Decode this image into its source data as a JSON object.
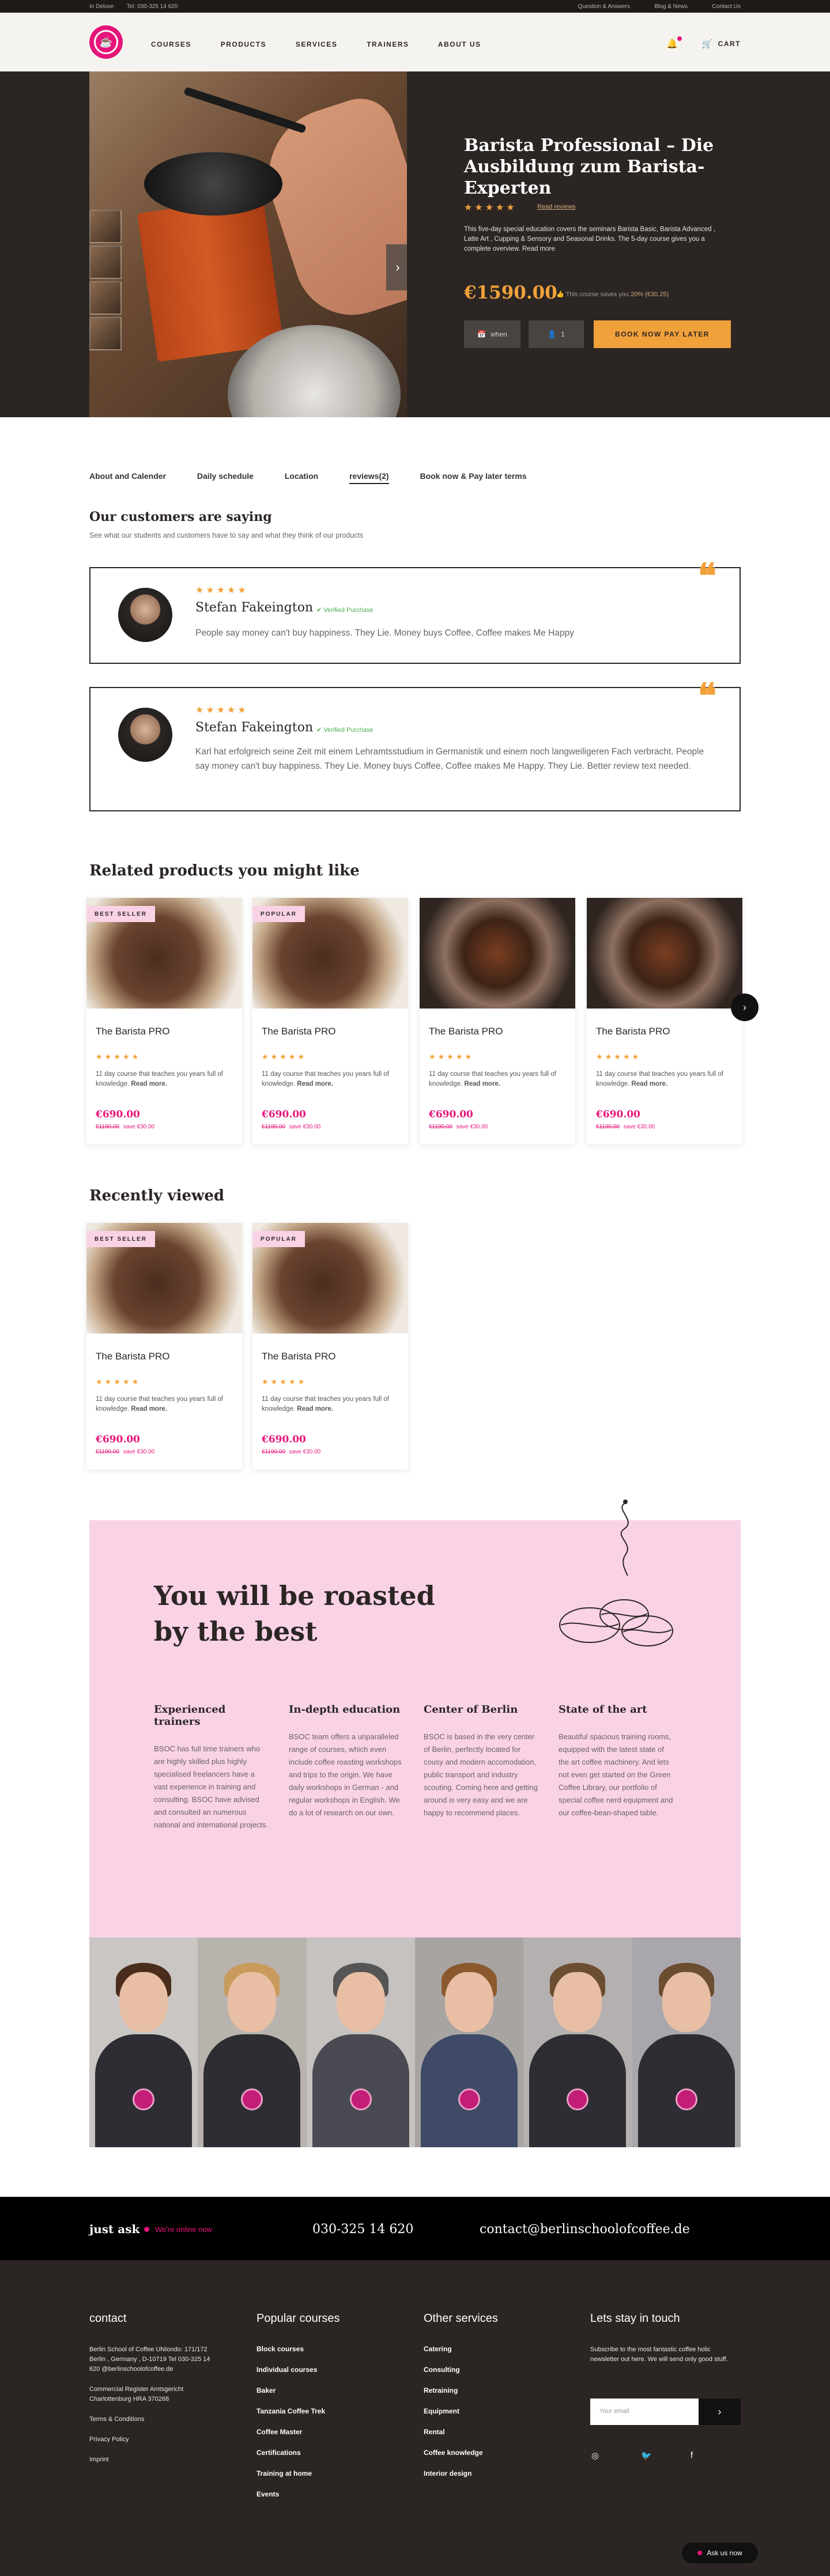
{
  "topbar": {
    "location": "In Deluxe",
    "phone": "Tel: 030-325 14 620",
    "links": [
      "Question & Answers",
      "Blog & News",
      "Contact Us"
    ]
  },
  "header": {
    "nav": [
      "COURSES",
      "PRODUCTS",
      "SERVICES",
      "TRAINERS",
      "ABOUT US"
    ],
    "cart": "CART"
  },
  "hero": {
    "title": "Barista Professional – Die Ausbildung zum Barista-Experten",
    "rating": "★★★★★",
    "read_reviews": "Read reviews",
    "description": "This five-day special education covers the seminars Barista Basic, Barista Advanced , Latte Art , Cupping & Sensory and Seasonal Drinks. The 5-day course gives you a complete overview. Read more",
    "price": "€1590.00",
    "save_prefix": "This course saves you",
    "save_value": "20% (€30.25)",
    "when_label": "when",
    "qty_label": "1",
    "book_button": "BOOK NOW PAY LATER"
  },
  "tabs": [
    "About and Calender",
    "Daily schedule",
    "Location",
    "reviews(2)",
    "Book now & Pay later terms"
  ],
  "reviews_section": {
    "title": "Our customers are saying",
    "subtitle": "See what our students and customers have to say and what they think of our products",
    "items": [
      {
        "stars": "★★★★★",
        "name": "Stefan Fakeington",
        "verified": "Verified Purchase",
        "text": "People say money can't buy happiness. They Lie. Money buys Coffee, Coffee makes Me Happy"
      },
      {
        "stars": "★★★★★",
        "name": "Stefan Fakeington",
        "verified": "Verified Purchase",
        "text": "Karl hat erfolgreich seine Zeit mit einem Lehramtsstudium in Germanistik und einem noch langweiligeren Fach verbracht. People say money can't buy happiness. They Lie. Money buys Coffee, Coffee makes Me Happy. They Lie. Better review text needed."
      }
    ]
  },
  "related": {
    "title": "Related products you might like",
    "cards": [
      {
        "badge": "BEST SELLER",
        "title": "The Barista PRO",
        "stars": "★★★★★",
        "desc": "11 day course that teaches you years full of knowledge.",
        "more": "Read more.",
        "price": "€690.00",
        "old_price": "€1190.00",
        "save": "€30.00"
      },
      {
        "badge": "POPULAR",
        "title": "The Barista PRO",
        "stars": "★★★★★",
        "desc": "11 day course that teaches you years full of knowledge.",
        "more": "Read more.",
        "price": "€690.00",
        "old_price": "€1190.00",
        "save": "€30.00"
      },
      {
        "badge": "",
        "title": "The Barista PRO",
        "stars": "★★★★★",
        "desc": "11 day course that teaches you years full of knowledge.",
        "more": "Read more.",
        "price": "€690.00",
        "old_price": "€1190.00",
        "save": "€30.00"
      },
      {
        "badge": "",
        "title": "The Barista PRO",
        "stars": "★★★★★",
        "desc": "11 day course that teaches you years full of knowledge.",
        "more": "Read more.",
        "price": "€690.00",
        "old_price": "€1190.00",
        "save": "€30.00"
      }
    ]
  },
  "recent": {
    "title": "Recently viewed",
    "cards": [
      {
        "badge": "BEST SELLER",
        "title": "The Barista PRO",
        "stars": "★★★★★",
        "desc": "11 day course that teaches you years full of knowledge.",
        "more": "Read more.",
        "price": "€690.00",
        "old_price": "€1190.00",
        "save": "€30.00"
      },
      {
        "badge": "POPULAR",
        "title": "The Barista PRO",
        "stars": "★★★★★",
        "desc": "11 day course that teaches you years full of knowledge.",
        "more": "Read more.",
        "price": "€690.00",
        "old_price": "€1190.00",
        "save": "€30.00"
      }
    ]
  },
  "promo": {
    "title_line1": "You will be roasted",
    "title_line2": "by the best",
    "columns": [
      {
        "title": "Experienced trainers",
        "text": "BSOC has full time trainers who are highly skilled plus highly specialised freelancers have a vast experience in training and consulting. BSOC have advised and consulted an numerous national and international projects."
      },
      {
        "title": "In-depth education",
        "text": "BSOC team offers a unparalleled range of courses, which even include coffee roasting workshops and trips to the origin. We have daily workshops in German - and regular workshops in English. We do a lot of research on our own."
      },
      {
        "title": "Center of Berlin",
        "text": "BSOC is based in the very center of Berlin, perfectly located for cousy and modern accomodation, public transport and industry scouting. Coming here and getting around is very easy and we are happy to recommend places."
      },
      {
        "title": "State of the art",
        "text": "Beautiful spacious training rooms, equipped with the latest state of the art coffee machinery. And lets not even get started on the Green Coffee Library, our portfolio of special coffee nerd equipment and our coffee-bean-shaped table."
      }
    ]
  },
  "contact_bar": {
    "ask": "just ask",
    "online": "We're online now",
    "phone": "030-325 14 620",
    "email": "contact@berlinschoolofcoffee.de"
  },
  "footer": {
    "contact": {
      "title": "contact",
      "address": "Berlin School of Coffee UNIondo: 171/172 Berlin , Germany , D-10719 Tel 030-325 14 620 @berlinschoolofcoffee.de",
      "register": "Commercial Register Amtsgericht Charlottenburg HRA 370268",
      "links": [
        "Terms & Conditions",
        "Privacy Policy",
        "Imprint"
      ]
    },
    "popular": {
      "title": "Popular courses",
      "links": [
        "Block courses",
        "Individual courses",
        "Baker",
        "Tanzania Coffee Trek",
        "Coffee Master",
        "Certifications",
        "Training at home",
        "Events"
      ]
    },
    "services": {
      "title": "Other services",
      "links": [
        "Catering",
        "Consulting",
        "Retraining",
        "Equipment",
        "Rental",
        "Coffee knowledge",
        "Interior design"
      ]
    },
    "newsletter": {
      "title": "Lets stay in touch",
      "text": "Subscribe to the most fantastic coffee holic newsletter out here. We will send only good stuff.",
      "placeholder": "Your email"
    },
    "ask_us": "Ask us now"
  },
  "colors": {
    "accent_pink": "#e6157a",
    "accent_orange": "#f1a13a",
    "dark": "#2b2624",
    "promo_bg": "#f9d2e6"
  }
}
